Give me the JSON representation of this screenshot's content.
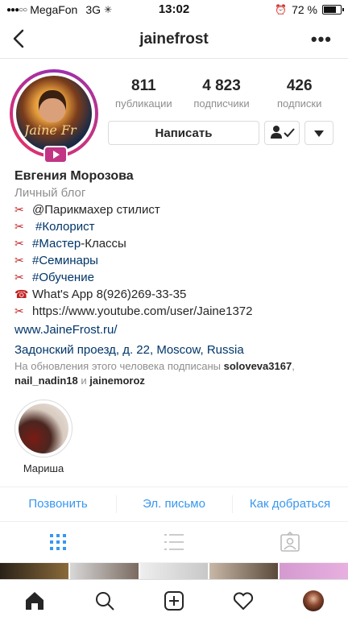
{
  "status": {
    "carrier": "MegaFon",
    "network": "3G",
    "time": "13:02",
    "battery": "72 %",
    "battery_level": 0.72
  },
  "nav": {
    "title": "jainefrost"
  },
  "profile": {
    "stats": [
      {
        "value": "811",
        "label": "публикации"
      },
      {
        "value": "4 823",
        "label": "подписчики"
      },
      {
        "value": "426",
        "label": "подписки"
      }
    ],
    "message_button": "Написать",
    "avatar_signature": "Jaine Fr"
  },
  "bio": {
    "name": "Евгения Морозова",
    "category": "Личный блог",
    "lines": [
      {
        "prefix": "@",
        "text": "Парикмахер стилист",
        "blue": false
      },
      {
        "prefix": " ",
        "text": "#Колорист",
        "blue": true
      },
      {
        "prefix": "",
        "text": "#Мастер",
        "blue": true,
        "suffix": "-Классы"
      },
      {
        "prefix": "",
        "text": "#Семинары",
        "blue": true
      },
      {
        "prefix": "",
        "text": "#Обучение",
        "blue": true
      },
      {
        "prefix": "",
        "text": "What's App 8(926)269-33-35",
        "blue": false
      },
      {
        "prefix": "",
        "text": "https://www.youtube.com/user/Jaine1372",
        "blue": false
      }
    ],
    "website": "www.JaineFrost.ru/",
    "address": "Задонский проезд, д. 22, Moscow, Russia"
  },
  "followed": {
    "prefix": "На обновления этого человека подписаны",
    "user1": "soloveva3167",
    "user2": "nail_nadin18",
    "conj": "и",
    "user3": "jainemoroz"
  },
  "highlights": [
    {
      "label": "Мариша"
    }
  ],
  "actions": {
    "call": "Позвонить",
    "email": "Эл. письмо",
    "directions": "Как добраться"
  },
  "colors": {
    "link": "#3897f0",
    "hashtag": "#003569",
    "ring": "#c13584"
  }
}
